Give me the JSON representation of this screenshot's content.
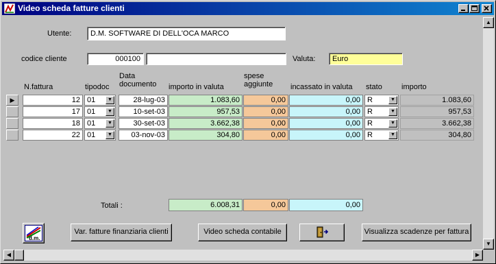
{
  "window": {
    "title": "Video scheda fatture clienti"
  },
  "form": {
    "utente_label": "Utente:",
    "utente_value": "D.M. SOFTWARE DI DELL'OCA MARCO",
    "codice_label": "codice cliente",
    "codice_value": "000100",
    "cliente_name": "",
    "valuta_label": "Valuta:",
    "valuta_value": "Euro"
  },
  "grid": {
    "headers": {
      "nfattura": "N.fattura",
      "tipodoc": "tipodoc",
      "data_documento": "Data documento",
      "importo_valuta": "importo in valuta",
      "spese": "spese aggiunte",
      "incassato": "incassato in valuta",
      "stato": "stato",
      "importo": "importo"
    },
    "rows": [
      {
        "n": "12",
        "tipo": "01",
        "data": "28-lug-03",
        "importo_valuta": "1.083,60",
        "spese": "0,00",
        "incassato": "0,00",
        "stato": "R",
        "importo": "1.083,60"
      },
      {
        "n": "17",
        "tipo": "01",
        "data": "10-set-03",
        "importo_valuta": "957,53",
        "spese": "0,00",
        "incassato": "0,00",
        "stato": "R",
        "importo": "957,53"
      },
      {
        "n": "18",
        "tipo": "01",
        "data": "30-set-03",
        "importo_valuta": "3.662,38",
        "spese": "0,00",
        "incassato": "0,00",
        "stato": "R",
        "importo": "3.662,38"
      },
      {
        "n": "22",
        "tipo": "01",
        "data": "03-nov-03",
        "importo_valuta": "304,80",
        "spese": "0,00",
        "incassato": "0,00",
        "stato": "R",
        "importo": "304,80"
      }
    ]
  },
  "totals": {
    "label": "Totali :",
    "importo_valuta": "6.008,31",
    "spese": "0,00",
    "incassato": "0,00"
  },
  "buttons": {
    "logo_text": "d.m.",
    "var_fatture": "Var. fatture finanziaria clienti",
    "video_contabile": "Video scheda contabile",
    "visualizza_scadenze": "Visualizza scadenze per fattura"
  },
  "icons": {
    "app": "app-icon",
    "exit": "door-exit-icon"
  },
  "colors": {
    "title_start": "#000080",
    "title_end": "#1084d0",
    "valuta_bg": "#ffff99",
    "importo_bg": "#c8ecc8",
    "spese_bg": "#f5c89a",
    "incassato_bg": "#c8f5fa"
  }
}
